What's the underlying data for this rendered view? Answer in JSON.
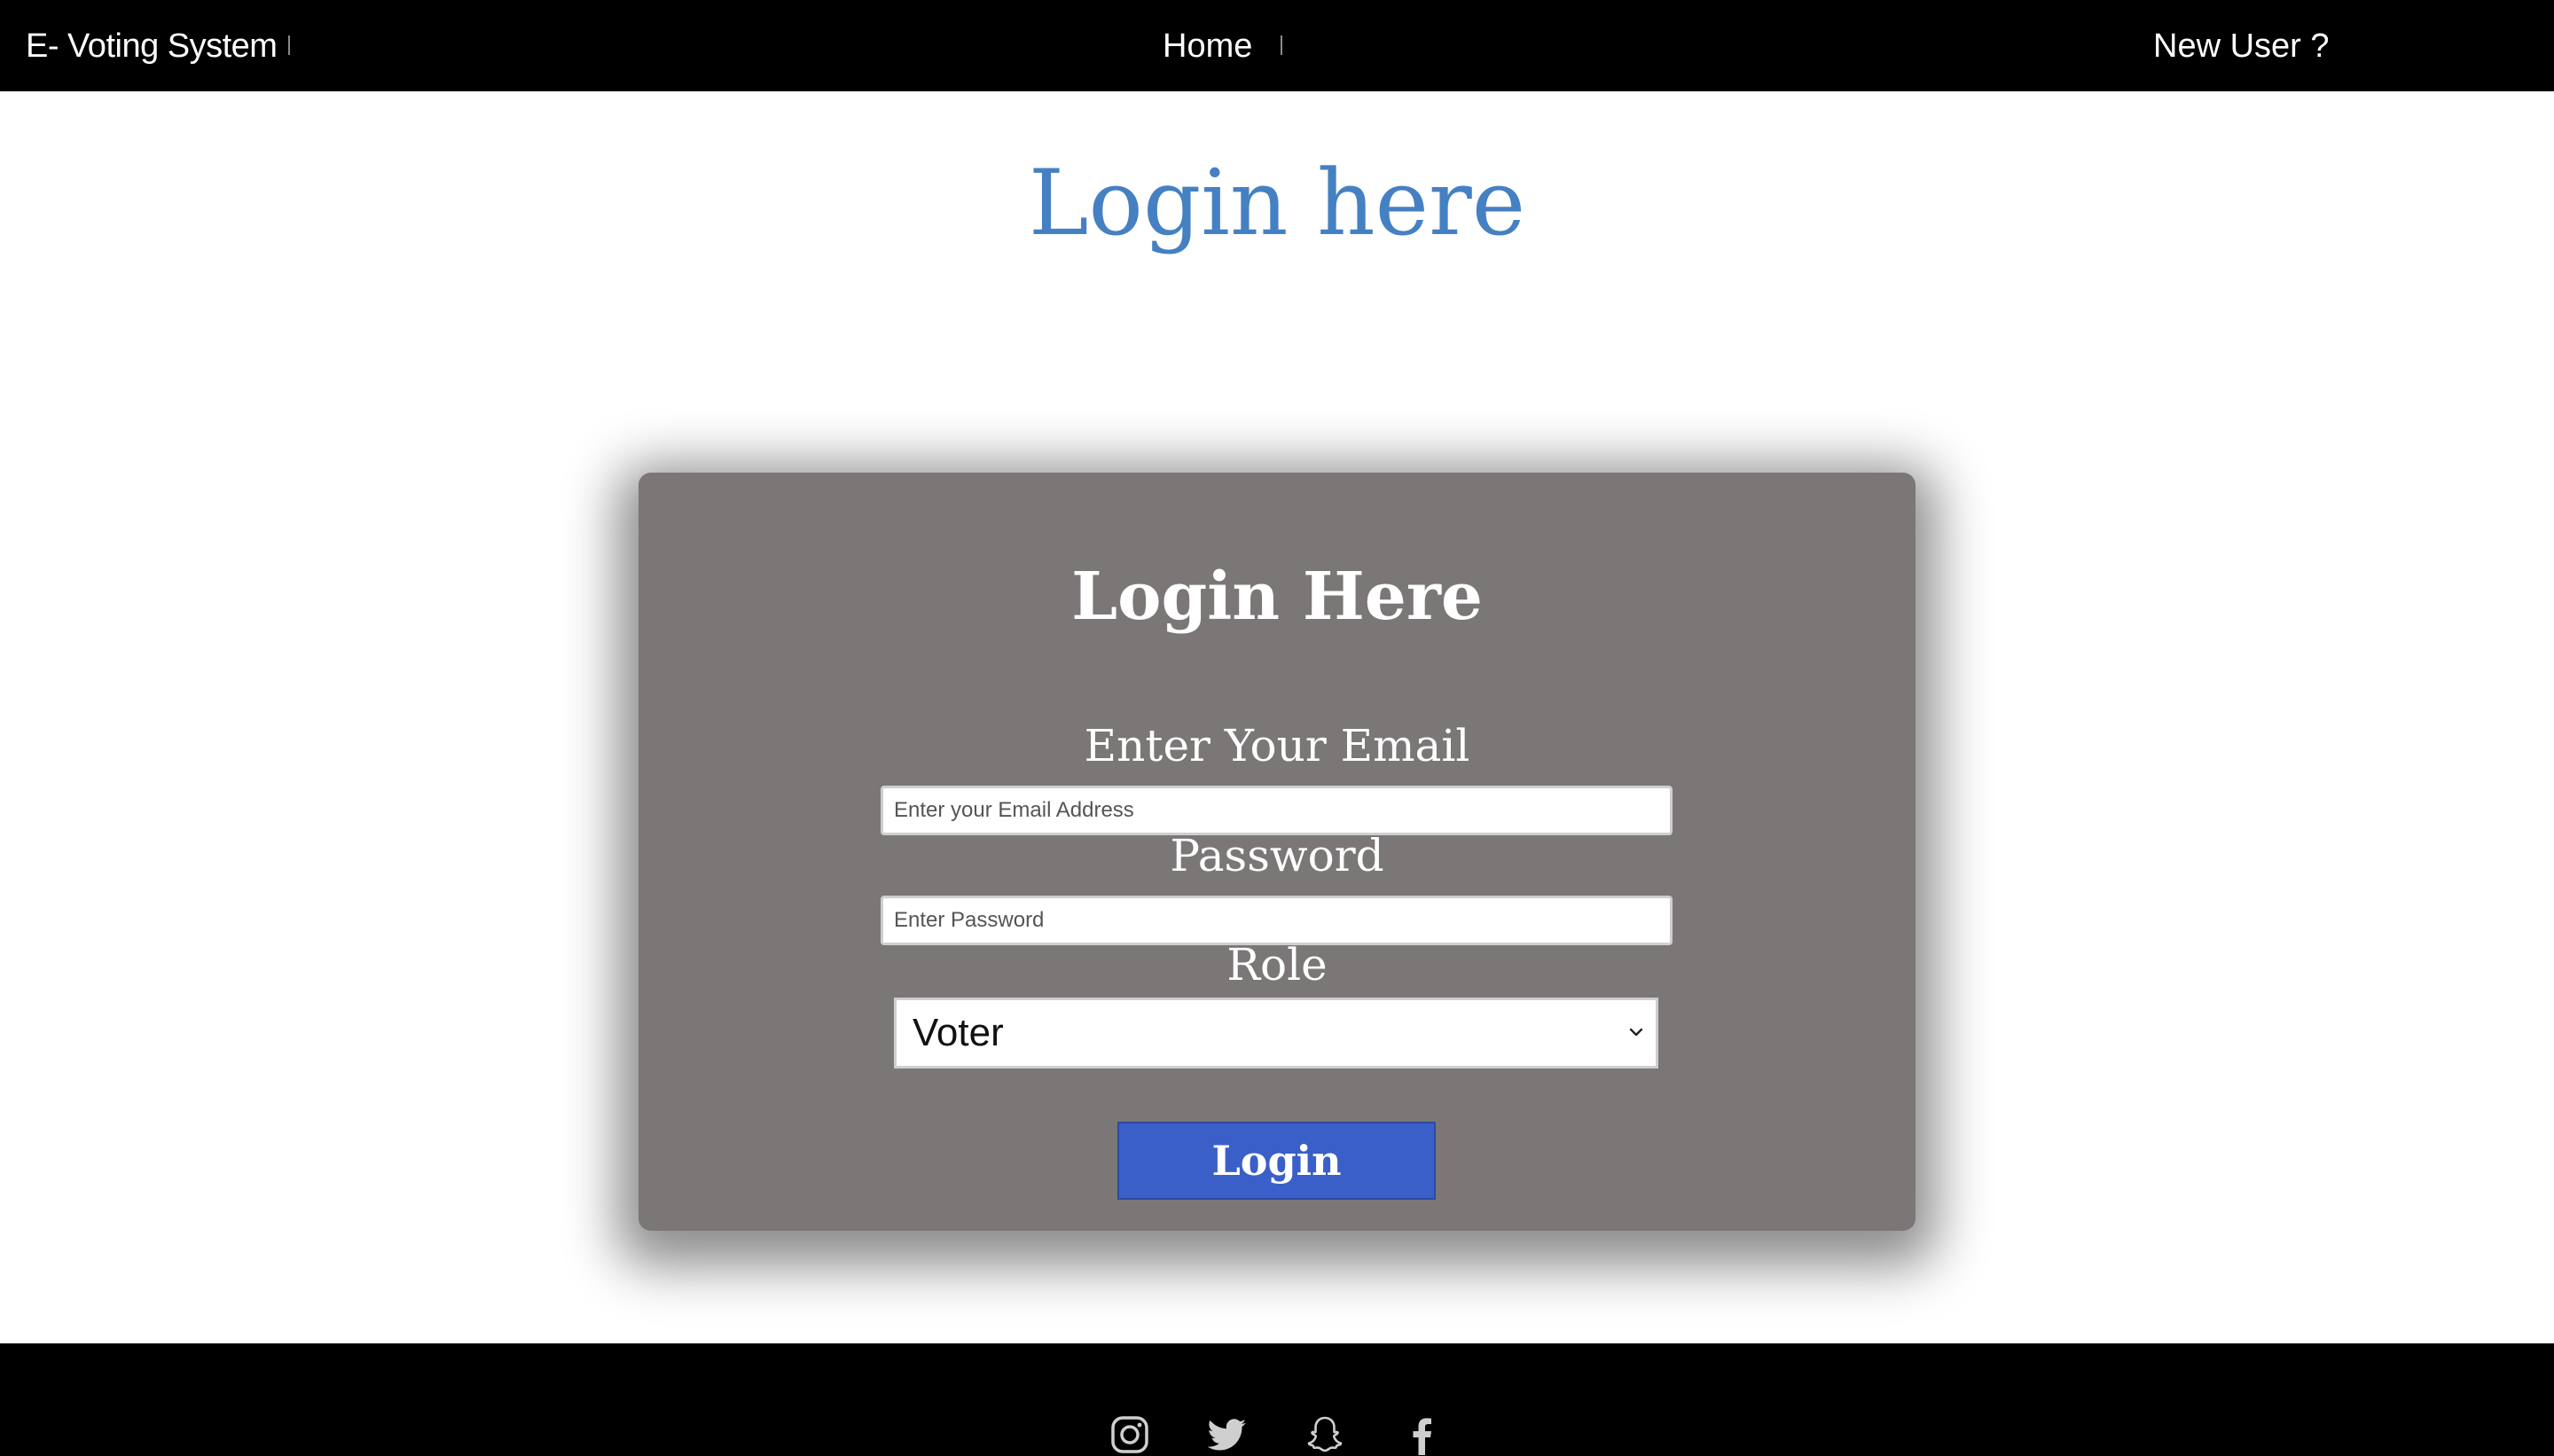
{
  "header": {
    "brand": "E- Voting System",
    "nav_home": "Home",
    "nav_new_user": "New User ?"
  },
  "page": {
    "title": "Login here"
  },
  "form": {
    "title": "Login Here",
    "email_label": "Enter Your Email",
    "email_placeholder": "Enter your Email Address",
    "email_value": "",
    "password_label": "Password",
    "password_placeholder": "Enter Password",
    "password_value": "",
    "role_label": "Role",
    "role_selected": "Voter",
    "submit_label": "Login"
  },
  "footer": {
    "social_icons": [
      "instagram-icon",
      "twitter-icon",
      "snapchat-icon",
      "facebook-icon"
    ]
  },
  "colors": {
    "header_bg": "#000000",
    "title_color": "#4580c3",
    "card_bg": "#7b7777",
    "button_bg": "#3a5fc8"
  }
}
